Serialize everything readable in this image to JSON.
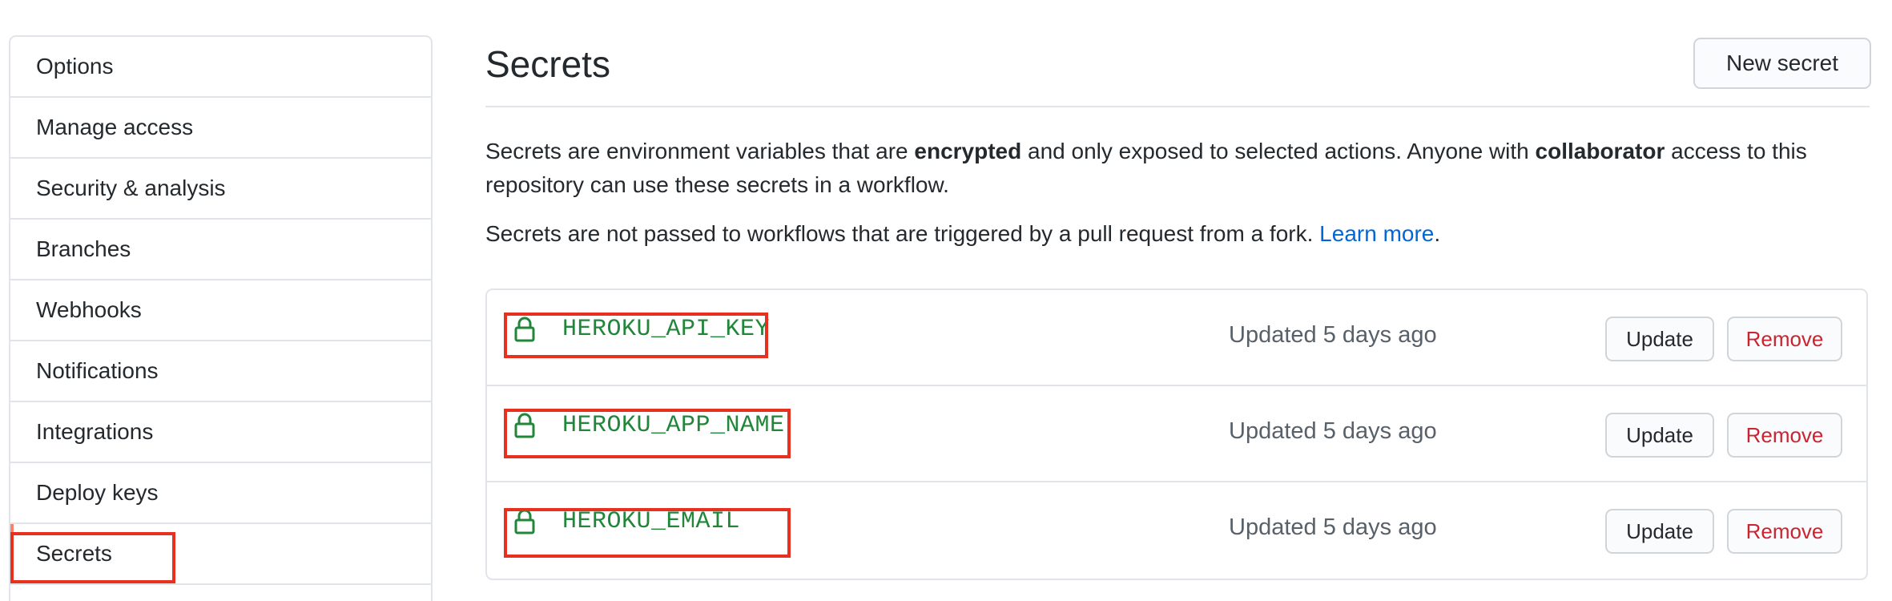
{
  "sidebar": {
    "items": [
      {
        "label": "Options"
      },
      {
        "label": "Manage access"
      },
      {
        "label": "Security & analysis"
      },
      {
        "label": "Branches"
      },
      {
        "label": "Webhooks"
      },
      {
        "label": "Notifications"
      },
      {
        "label": "Integrations"
      },
      {
        "label": "Deploy keys"
      },
      {
        "label": "Secrets",
        "selected": true
      }
    ]
  },
  "main": {
    "title": "Secrets",
    "new_secret_label": "New secret",
    "description": {
      "p1_a": "Secrets are environment variables that are ",
      "p1_b": "encrypted",
      "p1_c": " and only exposed to selected actions. Anyone with ",
      "p1_d": "collaborator",
      "p1_e": " access to this repository can use these secrets in a workflow.",
      "p2_a": "Secrets are not passed to workflows that are triggered by a pull request from a fork. ",
      "p2_link": "Learn more",
      "p2_end": "."
    },
    "secrets": [
      {
        "name": "HEROKU_API_KEY",
        "updated": "Updated 5 days ago",
        "update_label": "Update",
        "remove_label": "Remove"
      },
      {
        "name": "HEROKU_APP_NAME",
        "updated": "Updated 5 days ago",
        "update_label": "Update",
        "remove_label": "Remove"
      },
      {
        "name": "HEROKU_EMAIL",
        "updated": "Updated 5 days ago",
        "update_label": "Update",
        "remove_label": "Remove"
      }
    ]
  },
  "colors": {
    "accent_link": "#0366d6",
    "secret_name": "#22863a",
    "remove_text": "#cb2431",
    "highlight_annotation": "#e8301f",
    "selected_indicator": "#f9826c"
  },
  "icons": {
    "secret": "lock-icon"
  }
}
